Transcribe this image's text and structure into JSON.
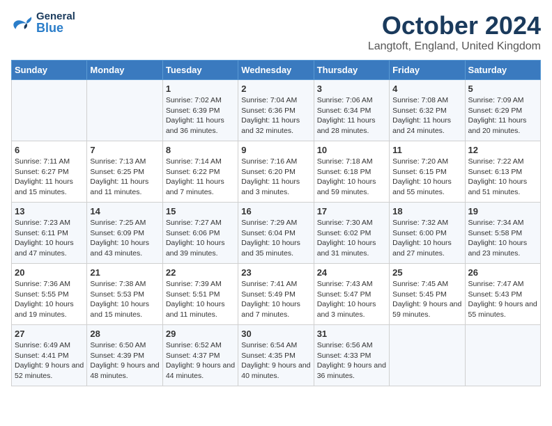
{
  "header": {
    "logo_general": "General",
    "logo_blue": "Blue",
    "month": "October 2024",
    "location": "Langtoft, England, United Kingdom"
  },
  "days_of_week": [
    "Sunday",
    "Monday",
    "Tuesday",
    "Wednesday",
    "Thursday",
    "Friday",
    "Saturday"
  ],
  "weeks": [
    [
      {
        "day": "",
        "sunrise": "",
        "sunset": "",
        "daylight": ""
      },
      {
        "day": "",
        "sunrise": "",
        "sunset": "",
        "daylight": ""
      },
      {
        "day": "1",
        "sunrise": "Sunrise: 7:02 AM",
        "sunset": "Sunset: 6:39 PM",
        "daylight": "Daylight: 11 hours and 36 minutes."
      },
      {
        "day": "2",
        "sunrise": "Sunrise: 7:04 AM",
        "sunset": "Sunset: 6:36 PM",
        "daylight": "Daylight: 11 hours and 32 minutes."
      },
      {
        "day": "3",
        "sunrise": "Sunrise: 7:06 AM",
        "sunset": "Sunset: 6:34 PM",
        "daylight": "Daylight: 11 hours and 28 minutes."
      },
      {
        "day": "4",
        "sunrise": "Sunrise: 7:08 AM",
        "sunset": "Sunset: 6:32 PM",
        "daylight": "Daylight: 11 hours and 24 minutes."
      },
      {
        "day": "5",
        "sunrise": "Sunrise: 7:09 AM",
        "sunset": "Sunset: 6:29 PM",
        "daylight": "Daylight: 11 hours and 20 minutes."
      }
    ],
    [
      {
        "day": "6",
        "sunrise": "Sunrise: 7:11 AM",
        "sunset": "Sunset: 6:27 PM",
        "daylight": "Daylight: 11 hours and 15 minutes."
      },
      {
        "day": "7",
        "sunrise": "Sunrise: 7:13 AM",
        "sunset": "Sunset: 6:25 PM",
        "daylight": "Daylight: 11 hours and 11 minutes."
      },
      {
        "day": "8",
        "sunrise": "Sunrise: 7:14 AM",
        "sunset": "Sunset: 6:22 PM",
        "daylight": "Daylight: 11 hours and 7 minutes."
      },
      {
        "day": "9",
        "sunrise": "Sunrise: 7:16 AM",
        "sunset": "Sunset: 6:20 PM",
        "daylight": "Daylight: 11 hours and 3 minutes."
      },
      {
        "day": "10",
        "sunrise": "Sunrise: 7:18 AM",
        "sunset": "Sunset: 6:18 PM",
        "daylight": "Daylight: 10 hours and 59 minutes."
      },
      {
        "day": "11",
        "sunrise": "Sunrise: 7:20 AM",
        "sunset": "Sunset: 6:15 PM",
        "daylight": "Daylight: 10 hours and 55 minutes."
      },
      {
        "day": "12",
        "sunrise": "Sunrise: 7:22 AM",
        "sunset": "Sunset: 6:13 PM",
        "daylight": "Daylight: 10 hours and 51 minutes."
      }
    ],
    [
      {
        "day": "13",
        "sunrise": "Sunrise: 7:23 AM",
        "sunset": "Sunset: 6:11 PM",
        "daylight": "Daylight: 10 hours and 47 minutes."
      },
      {
        "day": "14",
        "sunrise": "Sunrise: 7:25 AM",
        "sunset": "Sunset: 6:09 PM",
        "daylight": "Daylight: 10 hours and 43 minutes."
      },
      {
        "day": "15",
        "sunrise": "Sunrise: 7:27 AM",
        "sunset": "Sunset: 6:06 PM",
        "daylight": "Daylight: 10 hours and 39 minutes."
      },
      {
        "day": "16",
        "sunrise": "Sunrise: 7:29 AM",
        "sunset": "Sunset: 6:04 PM",
        "daylight": "Daylight: 10 hours and 35 minutes."
      },
      {
        "day": "17",
        "sunrise": "Sunrise: 7:30 AM",
        "sunset": "Sunset: 6:02 PM",
        "daylight": "Daylight: 10 hours and 31 minutes."
      },
      {
        "day": "18",
        "sunrise": "Sunrise: 7:32 AM",
        "sunset": "Sunset: 6:00 PM",
        "daylight": "Daylight: 10 hours and 27 minutes."
      },
      {
        "day": "19",
        "sunrise": "Sunrise: 7:34 AM",
        "sunset": "Sunset: 5:58 PM",
        "daylight": "Daylight: 10 hours and 23 minutes."
      }
    ],
    [
      {
        "day": "20",
        "sunrise": "Sunrise: 7:36 AM",
        "sunset": "Sunset: 5:55 PM",
        "daylight": "Daylight: 10 hours and 19 minutes."
      },
      {
        "day": "21",
        "sunrise": "Sunrise: 7:38 AM",
        "sunset": "Sunset: 5:53 PM",
        "daylight": "Daylight: 10 hours and 15 minutes."
      },
      {
        "day": "22",
        "sunrise": "Sunrise: 7:39 AM",
        "sunset": "Sunset: 5:51 PM",
        "daylight": "Daylight: 10 hours and 11 minutes."
      },
      {
        "day": "23",
        "sunrise": "Sunrise: 7:41 AM",
        "sunset": "Sunset: 5:49 PM",
        "daylight": "Daylight: 10 hours and 7 minutes."
      },
      {
        "day": "24",
        "sunrise": "Sunrise: 7:43 AM",
        "sunset": "Sunset: 5:47 PM",
        "daylight": "Daylight: 10 hours and 3 minutes."
      },
      {
        "day": "25",
        "sunrise": "Sunrise: 7:45 AM",
        "sunset": "Sunset: 5:45 PM",
        "daylight": "Daylight: 9 hours and 59 minutes."
      },
      {
        "day": "26",
        "sunrise": "Sunrise: 7:47 AM",
        "sunset": "Sunset: 5:43 PM",
        "daylight": "Daylight: 9 hours and 55 minutes."
      }
    ],
    [
      {
        "day": "27",
        "sunrise": "Sunrise: 6:49 AM",
        "sunset": "Sunset: 4:41 PM",
        "daylight": "Daylight: 9 hours and 52 minutes."
      },
      {
        "day": "28",
        "sunrise": "Sunrise: 6:50 AM",
        "sunset": "Sunset: 4:39 PM",
        "daylight": "Daylight: 9 hours and 48 minutes."
      },
      {
        "day": "29",
        "sunrise": "Sunrise: 6:52 AM",
        "sunset": "Sunset: 4:37 PM",
        "daylight": "Daylight: 9 hours and 44 minutes."
      },
      {
        "day": "30",
        "sunrise": "Sunrise: 6:54 AM",
        "sunset": "Sunset: 4:35 PM",
        "daylight": "Daylight: 9 hours and 40 minutes."
      },
      {
        "day": "31",
        "sunrise": "Sunrise: 6:56 AM",
        "sunset": "Sunset: 4:33 PM",
        "daylight": "Daylight: 9 hours and 36 minutes."
      },
      {
        "day": "",
        "sunrise": "",
        "sunset": "",
        "daylight": ""
      },
      {
        "day": "",
        "sunrise": "",
        "sunset": "",
        "daylight": ""
      }
    ]
  ]
}
